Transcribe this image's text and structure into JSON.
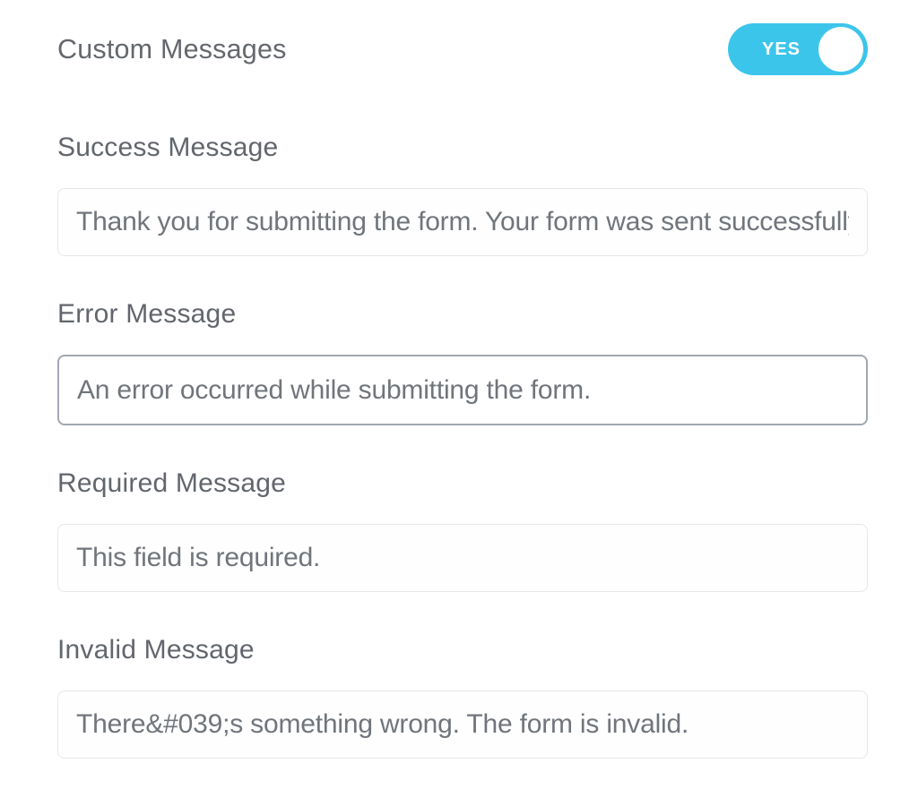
{
  "header": {
    "title": "Custom Messages"
  },
  "toggle": {
    "state_label": "YES"
  },
  "fields": {
    "success": {
      "label": "Success Message",
      "value": "Thank you for submitting the form. Your form was sent successfully."
    },
    "error": {
      "label": "Error Message",
      "value": "An error occurred while submitting the form."
    },
    "required": {
      "label": "Required Message",
      "value": "This field is required."
    },
    "invalid": {
      "label": "Invalid Message",
      "value": "There&#039;s something wrong. The form is invalid."
    }
  }
}
